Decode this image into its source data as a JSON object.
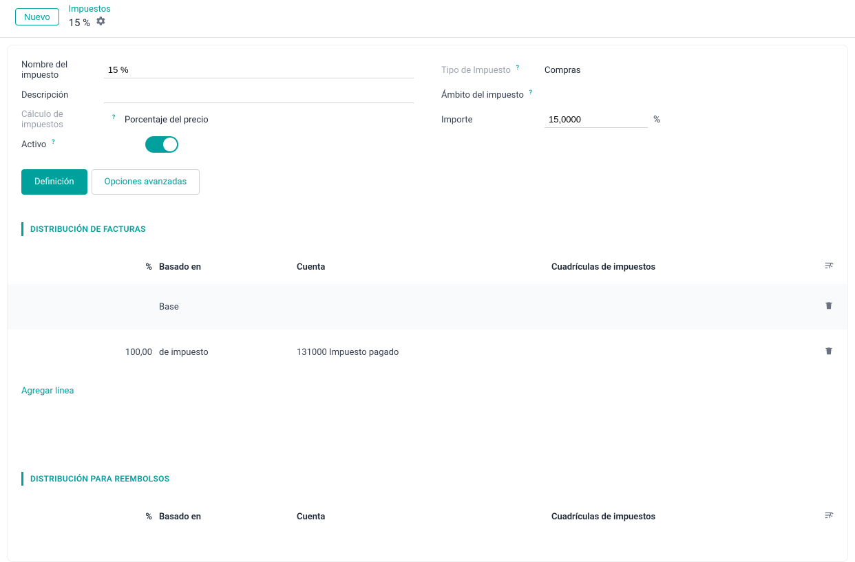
{
  "breadcrumb": {
    "nuevo": "Nuevo",
    "link": "Impuestos",
    "title": "15 %"
  },
  "form": {
    "labels": {
      "nombre": "Nombre del impuesto",
      "descripcion": "Descripción",
      "calculo": "Cálculo de impuestos",
      "activo": "Activo",
      "tipo": "Tipo de Impuesto",
      "ambito": "Ámbito del impuesto",
      "importe": "Importe"
    },
    "values": {
      "nombre": "15 %",
      "descripcion": "",
      "calculo": "Porcentaje del precio",
      "tipo": "Compras",
      "importe": "15,0000",
      "importe_unit": "%"
    }
  },
  "tabs": {
    "definicion": "Definición",
    "opciones": "Opciones avanzadas"
  },
  "sections": {
    "facturas": "DISTRIBUCIÓN DE FACTURAS",
    "reembolsos": "DISTRIBUCIÓN PARA REEMBOLSOS"
  },
  "table": {
    "headers": {
      "pct": "%",
      "basado": "Basado en",
      "cuenta": "Cuenta",
      "cuadriculas": "Cuadrículas de impuestos"
    },
    "facturas_rows": [
      {
        "pct": "",
        "basado": "Base",
        "cuenta": "",
        "cuadriculas": ""
      },
      {
        "pct": "100,00",
        "basado": "de impuesto",
        "cuenta": "131000 Impuesto pagado",
        "cuadriculas": ""
      }
    ],
    "add_line": "Agregar línea"
  }
}
